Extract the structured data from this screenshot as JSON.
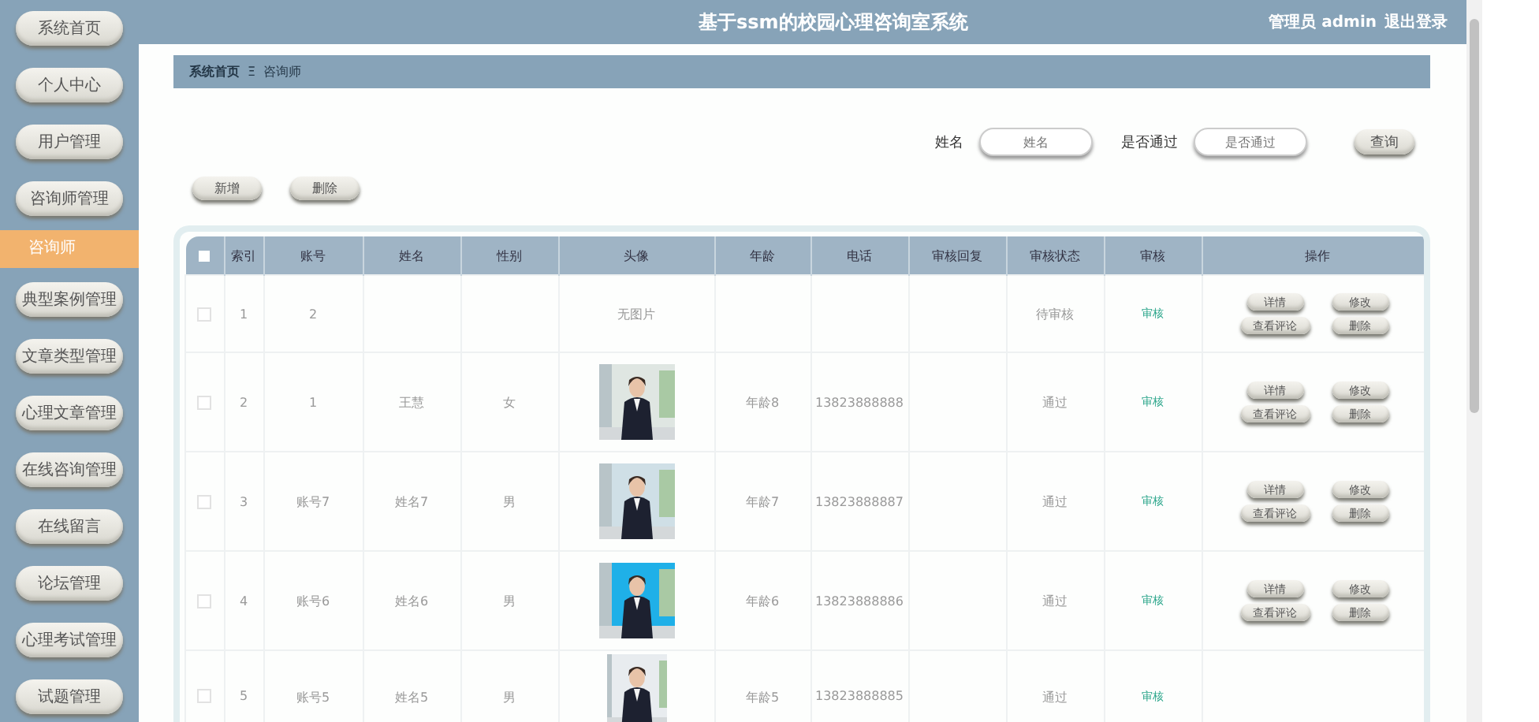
{
  "header": {
    "title": "基于ssm的校园心理咨询室系统",
    "user": "管理员 admin",
    "logout": "退出登录"
  },
  "sidebar": {
    "items": [
      {
        "label": "系统首页",
        "selected": false
      },
      {
        "label": "个人中心",
        "selected": false
      },
      {
        "label": "用户管理",
        "selected": false
      },
      {
        "label": "咨询师管理",
        "selected": false
      },
      {
        "label": "咨询师",
        "selected": true
      },
      {
        "label": "典型案例管理",
        "selected": false
      },
      {
        "label": "文章类型管理",
        "selected": false
      },
      {
        "label": "心理文章管理",
        "selected": false
      },
      {
        "label": "在线咨询管理",
        "selected": false
      },
      {
        "label": "在线留言",
        "selected": false
      },
      {
        "label": "论坛管理",
        "selected": false
      },
      {
        "label": "心理考试管理",
        "selected": false
      },
      {
        "label": "试题管理",
        "selected": false
      }
    ]
  },
  "breadcrumb": {
    "home": "系统首页",
    "separator": "Ξ",
    "current": "咨询师"
  },
  "search": {
    "fields": [
      {
        "label": "姓名",
        "placeholder": "姓名"
      },
      {
        "label": "是否通过",
        "placeholder": "是否通过"
      }
    ],
    "button": "查询"
  },
  "toolbar": [
    "新增",
    "删除"
  ],
  "table": {
    "select_all": {
      "checked": false
    },
    "columns": [
      "索引",
      "账号",
      "姓名",
      "性别",
      "头像",
      "年龄",
      "电话",
      "审核回复",
      "审核状态",
      "审核",
      "操作"
    ],
    "rows": [
      {
        "checked": false,
        "index": "1",
        "account": "2",
        "name": "",
        "gender": "",
        "avatar": {
          "kind": "text",
          "text": "无图片"
        },
        "age": "",
        "phone": "",
        "status": "待审核",
        "audit": "审核",
        "actions": [
          "详情",
          "修改",
          "查看评论",
          "删除"
        ]
      },
      {
        "checked": false,
        "index": "2",
        "account": "1",
        "name": "王慧",
        "gender": "女",
        "avatar": {
          "kind": "picture"
        },
        "age": "年龄8",
        "phone": "13823888888",
        "status": "通过",
        "audit": "审核",
        "actions": [
          "详情",
          "修改",
          "查看评论",
          "删除"
        ]
      },
      {
        "checked": false,
        "index": "3",
        "account": "账号7",
        "name": "姓名7",
        "gender": "男",
        "avatar": {
          "kind": "picture"
        },
        "age": "年龄7",
        "phone": "13823888887",
        "status": "通过",
        "audit": "审核",
        "actions": [
          "详情",
          "修改",
          "查看评论",
          "删除"
        ]
      },
      {
        "checked": false,
        "index": "4",
        "account": "账号6",
        "name": "姓名6",
        "gender": "男",
        "avatar": {
          "kind": "picture"
        },
        "age": "年龄6",
        "phone": "13823888886",
        "status": "通过",
        "audit": "审核",
        "actions": [
          "详情",
          "修改",
          "查看评论",
          "删除"
        ]
      },
      {
        "checked": false,
        "index": "5",
        "account": "账号5",
        "name": "姓名5",
        "gender": "男",
        "avatar": {
          "kind": "picture"
        },
        "age": "年龄5",
        "phone": "13823888885",
        "status": "通过",
        "audit": "审核",
        "actions": []
      }
    ]
  }
}
